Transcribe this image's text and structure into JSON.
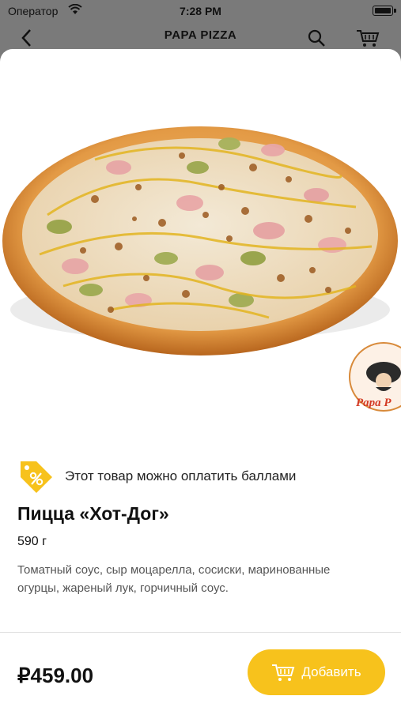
{
  "status_bar": {
    "carrier": "Оператор",
    "time": "7:28 PM"
  },
  "header": {
    "title": "PAPA PIZZA"
  },
  "points": {
    "text": "Этот товар можно оплатить баллами",
    "icon": "percent-tag-icon"
  },
  "product": {
    "title": "Пицца «Хот-Дог»",
    "weight": "590 г",
    "description": "Томатный соус, сыр моцарелла, сосиски, маринованные огурцы, жареный лук, горчичный соус."
  },
  "footer": {
    "price": "₽459.00",
    "add_label": "Добавить"
  },
  "colors": {
    "accent": "#f7c21c",
    "text": "#111111",
    "muted": "#555555"
  }
}
